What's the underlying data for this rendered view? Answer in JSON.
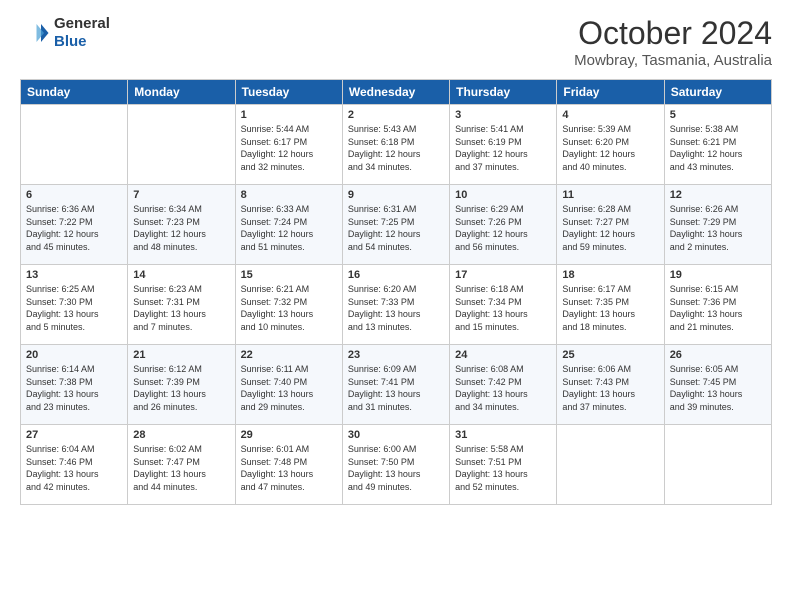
{
  "header": {
    "logo_general": "General",
    "logo_blue": "Blue",
    "month": "October 2024",
    "location": "Mowbray, Tasmania, Australia"
  },
  "days_of_week": [
    "Sunday",
    "Monday",
    "Tuesday",
    "Wednesday",
    "Thursday",
    "Friday",
    "Saturday"
  ],
  "weeks": [
    [
      {
        "day": "",
        "info": ""
      },
      {
        "day": "",
        "info": ""
      },
      {
        "day": "1",
        "info": "Sunrise: 5:44 AM\nSunset: 6:17 PM\nDaylight: 12 hours\nand 32 minutes."
      },
      {
        "day": "2",
        "info": "Sunrise: 5:43 AM\nSunset: 6:18 PM\nDaylight: 12 hours\nand 34 minutes."
      },
      {
        "day": "3",
        "info": "Sunrise: 5:41 AM\nSunset: 6:19 PM\nDaylight: 12 hours\nand 37 minutes."
      },
      {
        "day": "4",
        "info": "Sunrise: 5:39 AM\nSunset: 6:20 PM\nDaylight: 12 hours\nand 40 minutes."
      },
      {
        "day": "5",
        "info": "Sunrise: 5:38 AM\nSunset: 6:21 PM\nDaylight: 12 hours\nand 43 minutes."
      }
    ],
    [
      {
        "day": "6",
        "info": "Sunrise: 6:36 AM\nSunset: 7:22 PM\nDaylight: 12 hours\nand 45 minutes."
      },
      {
        "day": "7",
        "info": "Sunrise: 6:34 AM\nSunset: 7:23 PM\nDaylight: 12 hours\nand 48 minutes."
      },
      {
        "day": "8",
        "info": "Sunrise: 6:33 AM\nSunset: 7:24 PM\nDaylight: 12 hours\nand 51 minutes."
      },
      {
        "day": "9",
        "info": "Sunrise: 6:31 AM\nSunset: 7:25 PM\nDaylight: 12 hours\nand 54 minutes."
      },
      {
        "day": "10",
        "info": "Sunrise: 6:29 AM\nSunset: 7:26 PM\nDaylight: 12 hours\nand 56 minutes."
      },
      {
        "day": "11",
        "info": "Sunrise: 6:28 AM\nSunset: 7:27 PM\nDaylight: 12 hours\nand 59 minutes."
      },
      {
        "day": "12",
        "info": "Sunrise: 6:26 AM\nSunset: 7:29 PM\nDaylight: 13 hours\nand 2 minutes."
      }
    ],
    [
      {
        "day": "13",
        "info": "Sunrise: 6:25 AM\nSunset: 7:30 PM\nDaylight: 13 hours\nand 5 minutes."
      },
      {
        "day": "14",
        "info": "Sunrise: 6:23 AM\nSunset: 7:31 PM\nDaylight: 13 hours\nand 7 minutes."
      },
      {
        "day": "15",
        "info": "Sunrise: 6:21 AM\nSunset: 7:32 PM\nDaylight: 13 hours\nand 10 minutes."
      },
      {
        "day": "16",
        "info": "Sunrise: 6:20 AM\nSunset: 7:33 PM\nDaylight: 13 hours\nand 13 minutes."
      },
      {
        "day": "17",
        "info": "Sunrise: 6:18 AM\nSunset: 7:34 PM\nDaylight: 13 hours\nand 15 minutes."
      },
      {
        "day": "18",
        "info": "Sunrise: 6:17 AM\nSunset: 7:35 PM\nDaylight: 13 hours\nand 18 minutes."
      },
      {
        "day": "19",
        "info": "Sunrise: 6:15 AM\nSunset: 7:36 PM\nDaylight: 13 hours\nand 21 minutes."
      }
    ],
    [
      {
        "day": "20",
        "info": "Sunrise: 6:14 AM\nSunset: 7:38 PM\nDaylight: 13 hours\nand 23 minutes."
      },
      {
        "day": "21",
        "info": "Sunrise: 6:12 AM\nSunset: 7:39 PM\nDaylight: 13 hours\nand 26 minutes."
      },
      {
        "day": "22",
        "info": "Sunrise: 6:11 AM\nSunset: 7:40 PM\nDaylight: 13 hours\nand 29 minutes."
      },
      {
        "day": "23",
        "info": "Sunrise: 6:09 AM\nSunset: 7:41 PM\nDaylight: 13 hours\nand 31 minutes."
      },
      {
        "day": "24",
        "info": "Sunrise: 6:08 AM\nSunset: 7:42 PM\nDaylight: 13 hours\nand 34 minutes."
      },
      {
        "day": "25",
        "info": "Sunrise: 6:06 AM\nSunset: 7:43 PM\nDaylight: 13 hours\nand 37 minutes."
      },
      {
        "day": "26",
        "info": "Sunrise: 6:05 AM\nSunset: 7:45 PM\nDaylight: 13 hours\nand 39 minutes."
      }
    ],
    [
      {
        "day": "27",
        "info": "Sunrise: 6:04 AM\nSunset: 7:46 PM\nDaylight: 13 hours\nand 42 minutes."
      },
      {
        "day": "28",
        "info": "Sunrise: 6:02 AM\nSunset: 7:47 PM\nDaylight: 13 hours\nand 44 minutes."
      },
      {
        "day": "29",
        "info": "Sunrise: 6:01 AM\nSunset: 7:48 PM\nDaylight: 13 hours\nand 47 minutes."
      },
      {
        "day": "30",
        "info": "Sunrise: 6:00 AM\nSunset: 7:50 PM\nDaylight: 13 hours\nand 49 minutes."
      },
      {
        "day": "31",
        "info": "Sunrise: 5:58 AM\nSunset: 7:51 PM\nDaylight: 13 hours\nand 52 minutes."
      },
      {
        "day": "",
        "info": ""
      },
      {
        "day": "",
        "info": ""
      }
    ]
  ]
}
